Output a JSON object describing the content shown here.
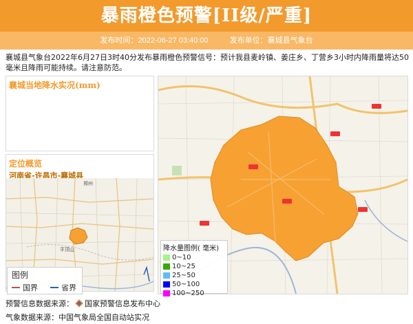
{
  "header": {
    "title": "暴雨橙色预警[II级/严重]",
    "publish_time": "发布时间：2022-06-27 03:40:00",
    "publisher": "发布单位：襄城县气象台"
  },
  "description": "襄城县气象台2022年6月27日3时40分发布暴雨橙色预警信号：预计我县麦岭镇、姜庄乡、丁营乡3小时内降雨量将达50毫米且降雨可能持续。请注意防范。",
  "rain_panel": {
    "title": "襄城当地降水实况(mm)"
  },
  "location_panel": {
    "title": "定位概览",
    "path": "河南省-许昌市-襄城县",
    "legend_title": "图例",
    "legend_items": [
      {
        "label": "国界",
        "color": "#c0504d"
      },
      {
        "label": "省界",
        "color": "#2a5fb0"
      }
    ]
  },
  "main_map": {
    "warning_area_color": "#f7a133"
  },
  "rain_legend": {
    "title": "降水量图例( 毫米)",
    "items": [
      {
        "label": "0~10",
        "color": "#a6f28f"
      },
      {
        "label": "10~25",
        "color": "#38a800"
      },
      {
        "label": "25~50",
        "color": "#61b8ff"
      },
      {
        "label": "50~100",
        "color": "#0000ff"
      },
      {
        "label": "100~250",
        "color": "#fa00fa"
      }
    ]
  },
  "footer": {
    "line1_prefix": "预警信息数据来源：",
    "line1_source": "国家预警信息发布中心",
    "line2": "气象数据来源：中国气象局全国自动站实况"
  }
}
